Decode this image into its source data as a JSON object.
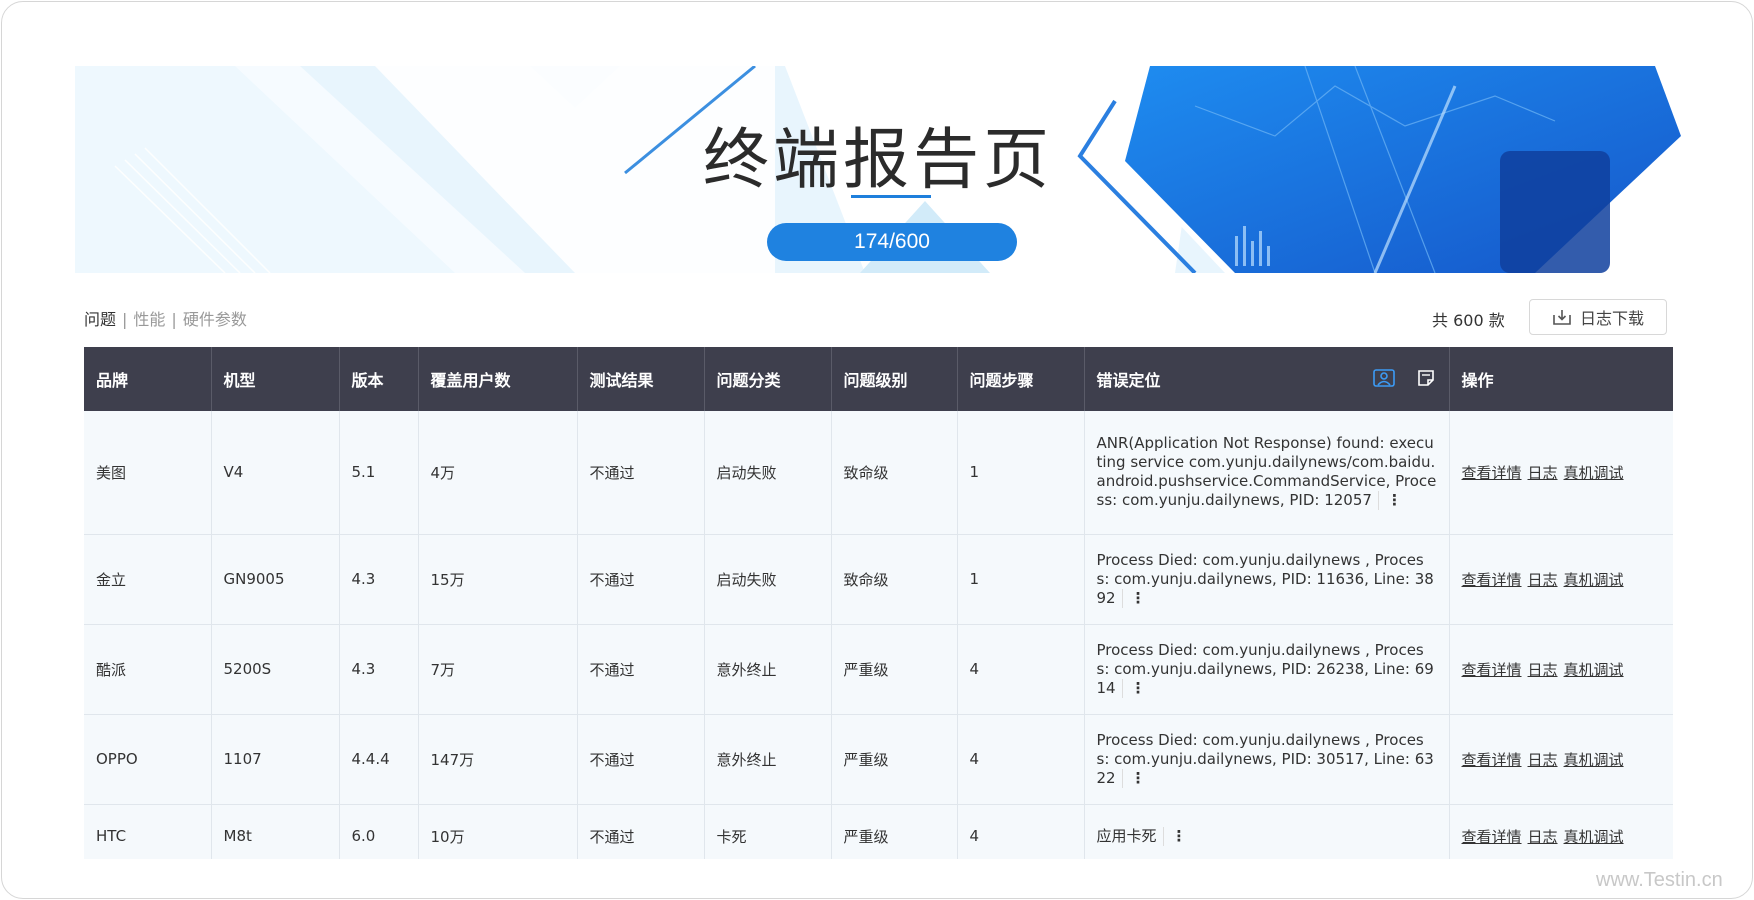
{
  "banner": {
    "title": "终端报告页",
    "progress": "174/600"
  },
  "tabs": [
    {
      "label": "问题",
      "active": true
    },
    {
      "label": "性能",
      "active": false
    },
    {
      "label": "硬件参数",
      "active": false
    }
  ],
  "tab_separator": "|",
  "summary": {
    "total": "共 600 款"
  },
  "download": {
    "label": "日志下载"
  },
  "table": {
    "headers": [
      "品牌",
      "机型",
      "版本",
      "覆盖用户数",
      "测试结果",
      "问题分类",
      "问题级别",
      "问题步骤",
      "错误定位",
      "操作"
    ],
    "actions": [
      "查看详情",
      "日志",
      "真机调试"
    ],
    "rows": [
      {
        "brand": "美图",
        "model": "V4",
        "version": "5.1",
        "users": "4万",
        "result": "不通过",
        "category": "启动失败",
        "level": "致命级",
        "step": "1",
        "error": "ANR(Application Not Response) found: executing service com.yunju.dailynews/com.baidu.android.pushservice.CommandService, Process: com.yunju.dailynews, PID: 12057"
      },
      {
        "brand": "金立",
        "model": "GN9005",
        "version": "4.3",
        "users": "15万",
        "result": "不通过",
        "category": "启动失败",
        "level": "致命级",
        "step": "1",
        "error": "Process Died: com.yunju.dailynews , Process: com.yunju.dailynews, PID: 11636, Line: 3892"
      },
      {
        "brand": "酷派",
        "model": "5200S",
        "version": "4.3",
        "users": "7万",
        "result": "不通过",
        "category": "意外终止",
        "level": "严重级",
        "step": "4",
        "error": "Process Died: com.yunju.dailynews , Process: com.yunju.dailynews, PID: 26238, Line: 6914"
      },
      {
        "brand": "OPPO",
        "model": "1107",
        "version": "4.4.4",
        "users": "147万",
        "result": "不通过",
        "category": "意外终止",
        "level": "严重级",
        "step": "4",
        "error": "Process Died: com.yunju.dailynews , Process: com.yunju.dailynews, PID: 30517, Line: 6322"
      },
      {
        "brand": "HTC",
        "model": "M8t",
        "version": "6.0",
        "users": "10万",
        "result": "不通过",
        "category": "卡死",
        "level": "严重级",
        "step": "4",
        "error": "应用卡死"
      }
    ]
  },
  "more_glyph": "⋮",
  "watermark": "www.Testin.cn",
  "colors": {
    "header_bg": "#3e3f4d",
    "accent": "#1f82e0",
    "row_bg": "#f5f9fc"
  },
  "icons": {
    "screenshot": "user-capture-icon",
    "note": "note-icon",
    "download": "download-tray-icon"
  }
}
